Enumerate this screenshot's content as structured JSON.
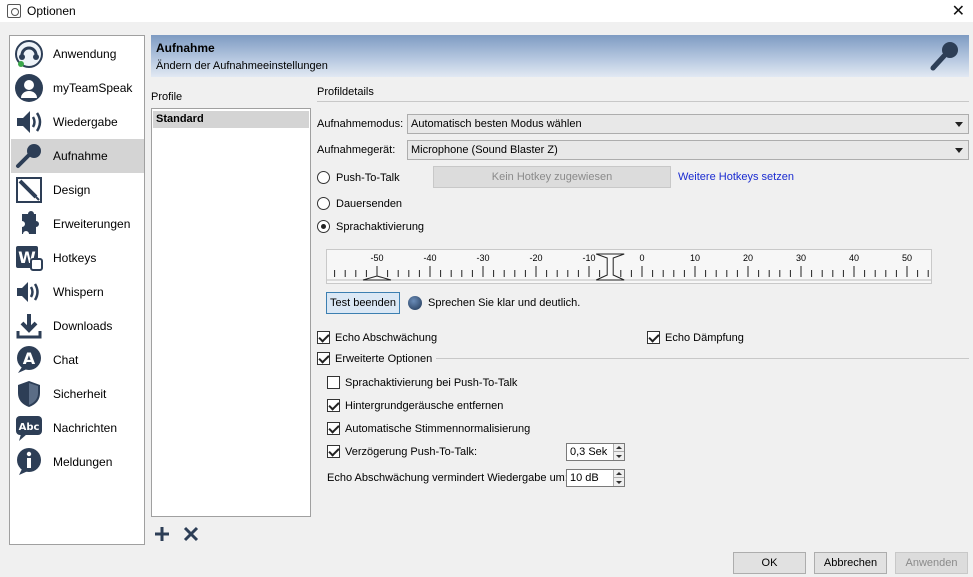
{
  "window": {
    "title": "Optionen",
    "close_label": "✕"
  },
  "nav": [
    {
      "label": "Anwendung",
      "icon": "teamspeak-icon"
    },
    {
      "label": "myTeamSpeak",
      "icon": "user-icon"
    },
    {
      "label": "Wiedergabe",
      "icon": "speaker-icon"
    },
    {
      "label": "Aufnahme",
      "icon": "microphone-icon",
      "selected": true
    },
    {
      "label": "Design",
      "icon": "design-icon"
    },
    {
      "label": "Erweiterungen",
      "icon": "puzzle-icon"
    },
    {
      "label": "Hotkeys",
      "icon": "keyboard-w-icon"
    },
    {
      "label": "Whispern",
      "icon": "whisper-icon"
    },
    {
      "label": "Downloads",
      "icon": "download-icon"
    },
    {
      "label": "Chat",
      "icon": "chat-icon"
    },
    {
      "label": "Sicherheit",
      "icon": "shield-icon"
    },
    {
      "label": "Nachrichten",
      "icon": "messages-abc-icon"
    },
    {
      "label": "Meldungen",
      "icon": "info-icon"
    }
  ],
  "header": {
    "title": "Aufnahme",
    "subtitle": "Ändern der Aufnahmeeinstellungen"
  },
  "profiles": {
    "heading": "Profile",
    "items": [
      "Standard"
    ]
  },
  "details": {
    "heading": "Profildetails",
    "mode_label": "Aufnahmemodus:",
    "mode_value": "Automatisch besten Modus wählen",
    "device_label": "Aufnahmegerät:",
    "device_value": "Microphone (Sound Blaster Z)",
    "ptt_label": "Push-To-Talk",
    "hotkey_button": "Kein Hotkey zugewiesen",
    "more_hotkeys": "Weitere Hotkeys setzen",
    "continuous_label": "Dauersenden",
    "voice_activation_label": "Sprachaktivierung",
    "meter_ticks": [
      "-50",
      "-40",
      "-30",
      "-20",
      "-10",
      "0",
      "10",
      "20",
      "30",
      "40",
      "50"
    ],
    "meter_threshold": -6,
    "test_button": "Test beenden",
    "test_hint": "Sprechen Sie klar und deutlich.",
    "echo_reduction": "Echo Abschwächung",
    "echo_damping": "Echo Dämpfung",
    "advanced_options": "Erweiterte Optionen",
    "va_ptt": "Sprachaktivierung bei Push-To-Talk",
    "remove_noise": "Hintergrundgeräusche entfernen",
    "auto_normalize": "Automatische Stimmennormalisierung",
    "ptt_delay_label": "Verzögerung Push-To-Talk:",
    "ptt_delay_value": "0,3 Sek",
    "echo_playback_label": "Echo Abschwächung vermindert Wiedergabe um:",
    "echo_playback_value": "10 dB"
  },
  "footer": {
    "ok": "OK",
    "cancel": "Abbrechen",
    "apply": "Anwenden"
  }
}
